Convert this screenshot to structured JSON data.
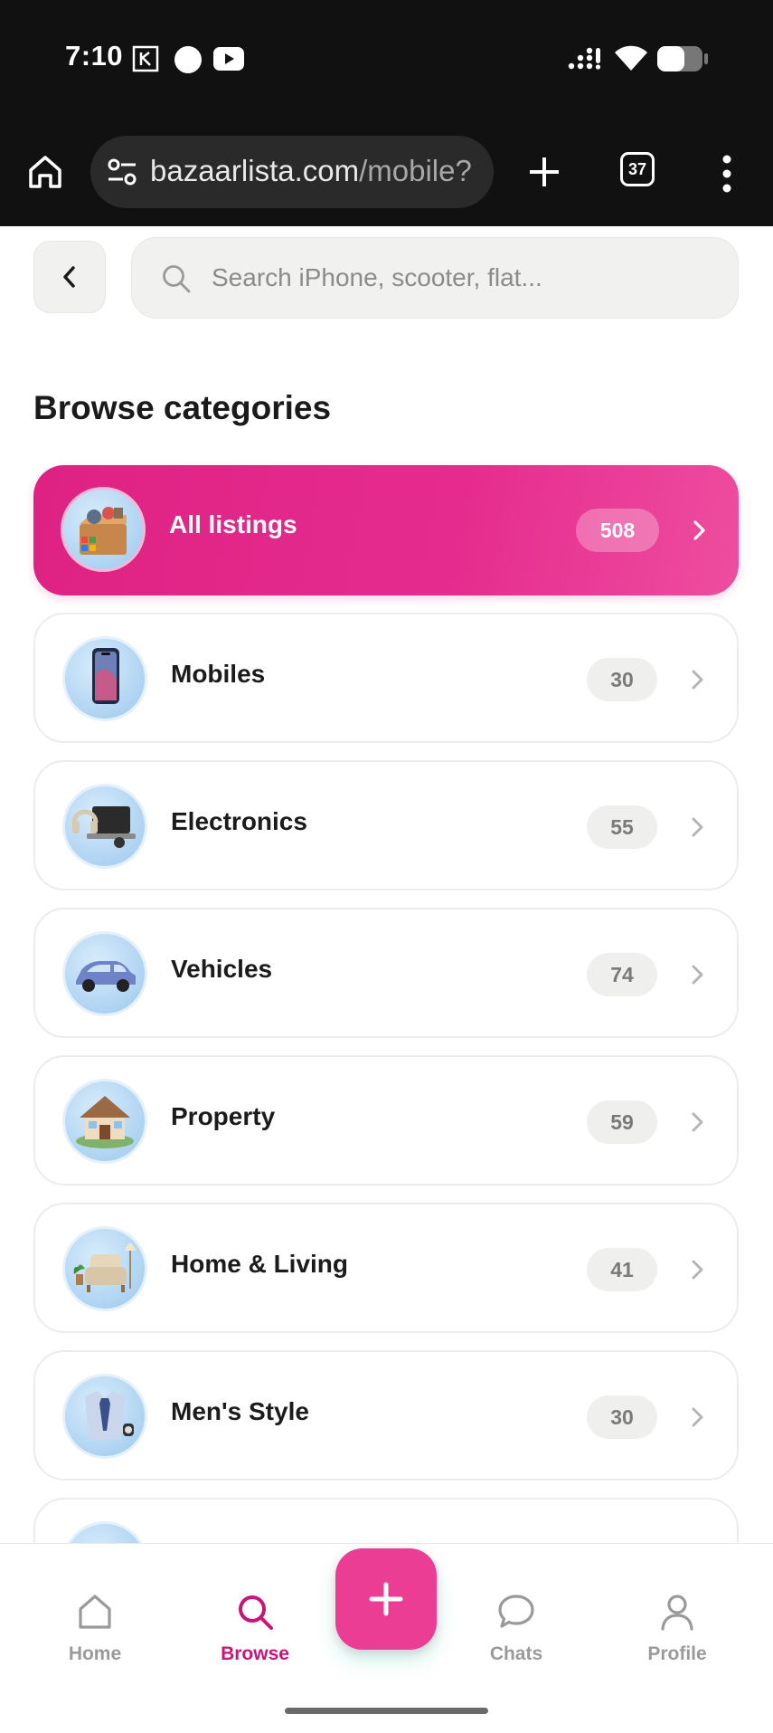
{
  "status_bar": {
    "time": "7:10",
    "icons": [
      "notification-k-icon",
      "circle-icon",
      "youtube-icon",
      "signal-icon",
      "wifi-icon",
      "battery-icon"
    ]
  },
  "browser": {
    "url_host": "bazaarlista.com",
    "url_path": "/mobile?",
    "tab_count": "37"
  },
  "search": {
    "placeholder": "Search iPhone, scooter, flat..."
  },
  "page": {
    "heading": "Browse categories"
  },
  "categories": [
    {
      "label": "All listings",
      "count": "508",
      "icon": "boxes-icon",
      "active": true
    },
    {
      "label": "Mobiles",
      "count": "30",
      "icon": "smartphone-icon",
      "active": false
    },
    {
      "label": "Electronics",
      "count": "55",
      "icon": "laptop-icon",
      "active": false
    },
    {
      "label": "Vehicles",
      "count": "74",
      "icon": "car-icon",
      "active": false
    },
    {
      "label": "Property",
      "count": "59",
      "icon": "house-icon",
      "active": false
    },
    {
      "label": "Home & Living",
      "count": "41",
      "icon": "armchair-icon",
      "active": false
    },
    {
      "label": "Men's Style",
      "count": "30",
      "icon": "shirt-icon",
      "active": false
    }
  ],
  "bottom_nav": {
    "items": [
      {
        "label": "Home",
        "icon": "home-icon",
        "active": false
      },
      {
        "label": "Browse",
        "icon": "search-icon",
        "active": true
      },
      {
        "label": "Chats",
        "icon": "chat-bubble-icon",
        "active": false
      },
      {
        "label": "Profile",
        "icon": "person-icon",
        "active": false
      }
    ],
    "fab_icon": "plus-icon"
  },
  "colors": {
    "accent": "#e52c8e",
    "active_nav": "#c8157a",
    "status_bar": "#111111"
  }
}
